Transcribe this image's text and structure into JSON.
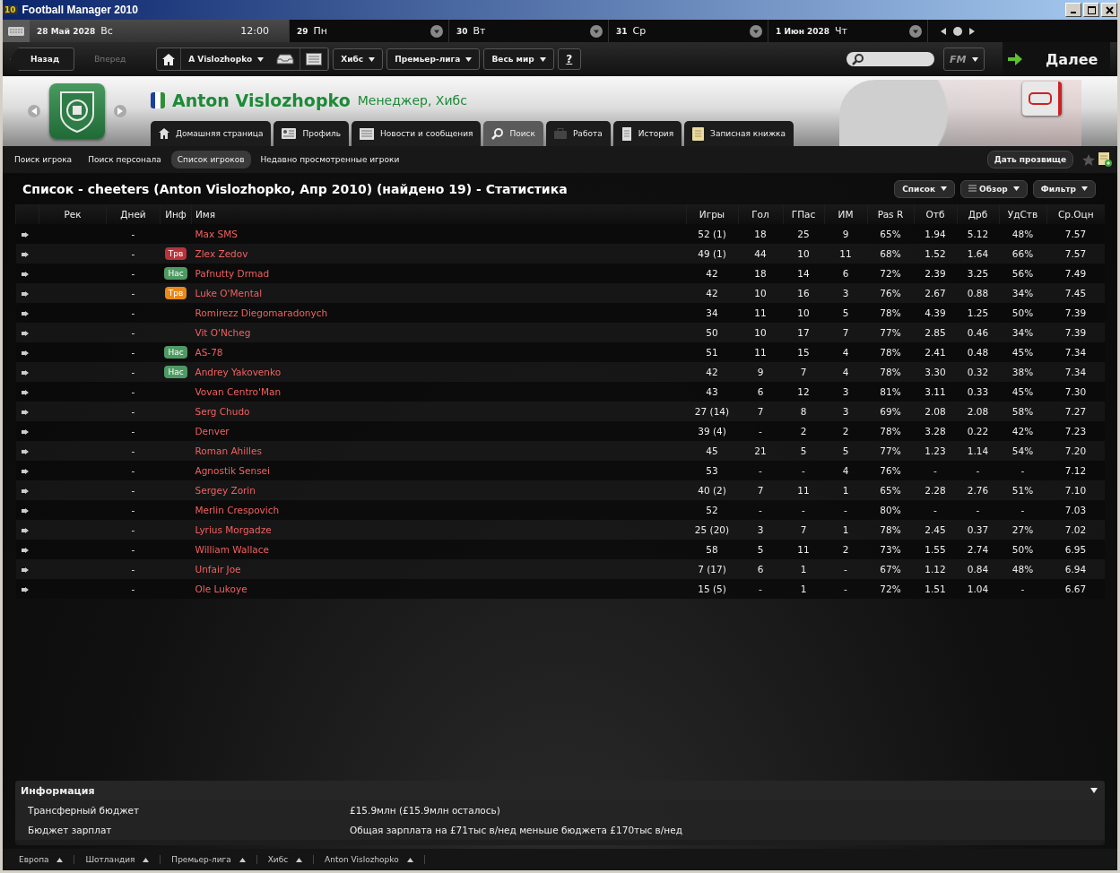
{
  "window": {
    "title": "Football Manager 2010",
    "logo": "10"
  },
  "calendar": {
    "time": "12:00",
    "days": [
      {
        "date": "28 Май 2028",
        "weekday": "Вс",
        "selected": true
      },
      {
        "date": "29",
        "weekday": "Пн",
        "selected": false
      },
      {
        "date": "30",
        "weekday": "Вт",
        "selected": false
      },
      {
        "date": "31",
        "weekday": "Ср",
        "selected": false
      },
      {
        "date": "1 Июн 2028",
        "weekday": "Чт",
        "selected": false
      }
    ]
  },
  "nav": {
    "back": {
      "label": "Назад",
      "disabled": false
    },
    "forward": {
      "label": "Вперед",
      "disabled": true
    },
    "menus": [
      "A Vislozhopko",
      "Хибс",
      "Премьер-лига",
      "Весь мир"
    ],
    "help": "?",
    "fm": "FM",
    "continue": "Далее"
  },
  "header": {
    "name": "Anton Vislozhopko",
    "role": "Менеджер, Хибс",
    "tabs": [
      {
        "label": "Домашняя страница",
        "selected": false
      },
      {
        "label": "Профиль",
        "selected": false
      },
      {
        "label": "Новости и сообщения",
        "selected": false
      },
      {
        "label": "Поиск",
        "selected": true
      },
      {
        "label": "Работа",
        "selected": false
      },
      {
        "label": "История",
        "selected": false
      },
      {
        "label": "Записная книжка",
        "selected": false
      }
    ]
  },
  "subtabs": [
    {
      "label": "Поиск игрока",
      "selected": false
    },
    {
      "label": "Поиск персонала",
      "selected": false
    },
    {
      "label": "Список игроков",
      "selected": true
    },
    {
      "label": "Недавно просмотренные игроки",
      "selected": false
    }
  ],
  "nickname_button": "Дать прозвище",
  "list": {
    "title": "Список - cheeters (Anton Vislozhopko, Апр 2010) (найдено 19) - Статистика",
    "view_buttons": [
      "Список",
      "Обзор",
      "Фильтр"
    ],
    "columns": [
      "Рек",
      "Дней",
      "Инф",
      "Имя",
      "Игры",
      "Гол",
      "ГПас",
      "ИМ",
      "Pas R",
      "Отб",
      "Дрб",
      "УдСтв",
      "Ср.Оцн"
    ],
    "rows": [
      {
        "days": "-",
        "name": "Max SMS",
        "stats": [
          "52 (1)",
          "18",
          "25",
          "9",
          "65%",
          "1.94",
          "5.12",
          "48%",
          "7.57"
        ]
      },
      {
        "days": "-",
        "badge": {
          "label": "Трв",
          "color": "#b8333a"
        },
        "name": "Zlex Zedov",
        "stats": [
          "49 (1)",
          "44",
          "10",
          "11",
          "68%",
          "1.52",
          "1.64",
          "66%",
          "7.57"
        ]
      },
      {
        "days": "-",
        "badge": {
          "label": "Нас",
          "color": "#4f9a63"
        },
        "name": "Pafnutty Drmad",
        "stats": [
          "42",
          "18",
          "14",
          "6",
          "72%",
          "2.39",
          "3.25",
          "56%",
          "7.49"
        ]
      },
      {
        "days": "-",
        "badge": {
          "label": "Трв",
          "color": "#e8891a"
        },
        "name": "Luke O'Mental",
        "stats": [
          "42",
          "10",
          "16",
          "3",
          "76%",
          "2.67",
          "0.88",
          "34%",
          "7.45"
        ]
      },
      {
        "days": "-",
        "name": "Romirezz Diegomaradonych",
        "stats": [
          "34",
          "11",
          "10",
          "5",
          "78%",
          "4.39",
          "1.25",
          "50%",
          "7.39"
        ]
      },
      {
        "days": "-",
        "name": "Vit O'Ncheg",
        "stats": [
          "50",
          "10",
          "17",
          "7",
          "77%",
          "2.85",
          "0.46",
          "34%",
          "7.39"
        ]
      },
      {
        "days": "-",
        "badge": {
          "label": "Нас",
          "color": "#4f9a63"
        },
        "name": "AS-78",
        "stats": [
          "51",
          "11",
          "15",
          "4",
          "78%",
          "2.41",
          "0.48",
          "45%",
          "7.34"
        ]
      },
      {
        "days": "-",
        "badge": {
          "label": "Нас",
          "color": "#4f9a63"
        },
        "name": "Andrey Yakovenko",
        "stats": [
          "42",
          "9",
          "7",
          "4",
          "78%",
          "3.30",
          "0.32",
          "38%",
          "7.34"
        ]
      },
      {
        "days": "-",
        "name": "Vovan Centro'Man",
        "stats": [
          "43",
          "6",
          "12",
          "3",
          "81%",
          "3.11",
          "0.33",
          "45%",
          "7.30"
        ]
      },
      {
        "days": "-",
        "name": "Serg Chudo",
        "stats": [
          "27 (14)",
          "7",
          "8",
          "3",
          "69%",
          "2.08",
          "2.08",
          "58%",
          "7.27"
        ]
      },
      {
        "days": "-",
        "name": "Denver",
        "stats": [
          "39 (4)",
          "-",
          "2",
          "2",
          "78%",
          "3.28",
          "0.22",
          "42%",
          "7.23"
        ]
      },
      {
        "days": "-",
        "name": "Roman Ahilles",
        "stats": [
          "45",
          "21",
          "5",
          "5",
          "77%",
          "1.23",
          "1.14",
          "54%",
          "7.20"
        ]
      },
      {
        "days": "-",
        "name": "Agnostik Sensei",
        "stats": [
          "53",
          "-",
          "-",
          "4",
          "76%",
          "-",
          "-",
          "-",
          "7.12"
        ]
      },
      {
        "days": "-",
        "name": "Sergey Zorin",
        "stats": [
          "40 (2)",
          "7",
          "11",
          "1",
          "65%",
          "2.28",
          "2.76",
          "51%",
          "7.10"
        ]
      },
      {
        "days": "-",
        "name": "Merlin Crespovich",
        "stats": [
          "52",
          "-",
          "-",
          "-",
          "80%",
          "-",
          "-",
          "-",
          "7.03"
        ]
      },
      {
        "days": "-",
        "name": "Lyrius Morgadze",
        "stats": [
          "25 (20)",
          "3",
          "7",
          "1",
          "78%",
          "2.45",
          "0.37",
          "27%",
          "7.02"
        ]
      },
      {
        "days": "-",
        "name": "William Wallace",
        "stats": [
          "58",
          "5",
          "11",
          "2",
          "73%",
          "1.55",
          "2.74",
          "50%",
          "6.95"
        ]
      },
      {
        "days": "-",
        "name": "Unfair Joe",
        "stats": [
          "7 (17)",
          "6",
          "1",
          "-",
          "67%",
          "1.12",
          "0.84",
          "48%",
          "6.94"
        ]
      },
      {
        "days": "-",
        "name": "Ole Lukoye",
        "stats": [
          "15 (5)",
          "-",
          "1",
          "-",
          "72%",
          "1.51",
          "1.04",
          "-",
          "6.67"
        ]
      }
    ]
  },
  "info": {
    "title": "Информация",
    "rows": [
      {
        "label": "Трансферный бюджет",
        "value": "£15.9млн (£15.9млн осталось)"
      },
      {
        "label": "Бюджет зарплат",
        "value": "Общая зарплата на £71тыс в/нед меньше бюджета £170тыс в/нед"
      }
    ]
  },
  "footer": [
    "Европа",
    "Шотландия",
    "Премьер-лига",
    "Хибс",
    "Anton Vislozhopko"
  ]
}
